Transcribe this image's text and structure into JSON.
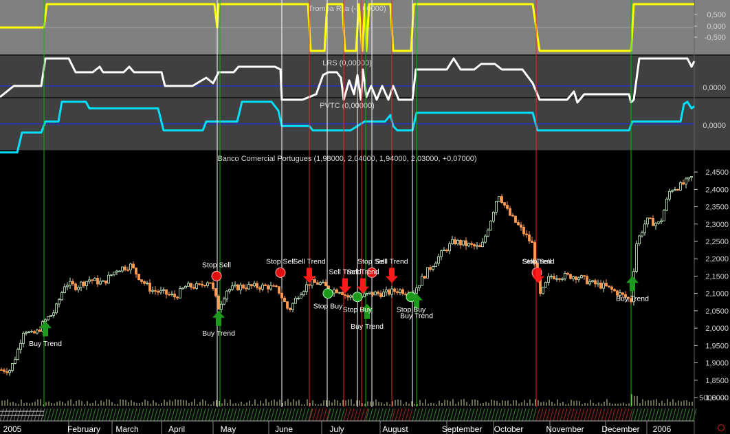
{
  "panels": {
    "tromba": {
      "title": "Tromba Rija (-1,00000)",
      "ticks": [
        "0,500",
        "0,000",
        "-0,500"
      ],
      "color": "#ffff00",
      "values": [
        [
          0,
          0
        ],
        [
          64,
          0
        ],
        [
          68,
          1
        ],
        [
          312,
          1
        ],
        [
          316,
          0
        ],
        [
          318,
          1
        ],
        [
          448,
          1
        ],
        [
          452,
          -1
        ],
        [
          472,
          -1
        ],
        [
          476,
          1
        ],
        [
          498,
          1
        ],
        [
          502,
          -1
        ],
        [
          518,
          -1
        ],
        [
          522,
          1
        ],
        [
          527,
          -1
        ],
        [
          531,
          1
        ],
        [
          533,
          -1
        ],
        [
          537,
          1
        ],
        [
          568,
          1
        ],
        [
          572,
          -1
        ],
        [
          598,
          -1
        ],
        [
          602,
          1
        ],
        [
          608,
          1
        ],
        [
          775,
          1
        ],
        [
          785,
          -1
        ],
        [
          918,
          -1
        ],
        [
          922,
          1
        ],
        [
          1010,
          1
        ]
      ]
    },
    "lrs": {
      "title": "LRS (0,00000)",
      "ticks": [
        "0,0000"
      ],
      "color": "#ffffff",
      "values": [
        [
          0,
          -0.4
        ],
        [
          20,
          0
        ],
        [
          60,
          0
        ],
        [
          66,
          1
        ],
        [
          100,
          1
        ],
        [
          110,
          0.5
        ],
        [
          135,
          0.5
        ],
        [
          145,
          0.7
        ],
        [
          150,
          0.5
        ],
        [
          180,
          0.5
        ],
        [
          188,
          0.7
        ],
        [
          195,
          0.5
        ],
        [
          235,
          0.5
        ],
        [
          240,
          0
        ],
        [
          268,
          0
        ],
        [
          280,
          0
        ],
        [
          300,
          0.3
        ],
        [
          310,
          0.1
        ],
        [
          318,
          0.5
        ],
        [
          340,
          0.5
        ],
        [
          347,
          0.7
        ],
        [
          400,
          0.7
        ],
        [
          408,
          0.6
        ],
        [
          410,
          -0.5
        ],
        [
          440,
          -0.5
        ],
        [
          460,
          -0.3
        ],
        [
          470,
          0.4
        ],
        [
          478,
          0.5
        ],
        [
          490,
          0.5
        ],
        [
          496,
          0.3
        ],
        [
          500,
          -0.5
        ],
        [
          508,
          0.2
        ],
        [
          515,
          -0.3
        ],
        [
          520,
          0.4
        ],
        [
          525,
          -0.5
        ],
        [
          528,
          0.6
        ],
        [
          533,
          -0.4
        ],
        [
          540,
          0
        ],
        [
          548,
          -0.5
        ],
        [
          556,
          0
        ],
        [
          565,
          -0.5
        ],
        [
          572,
          0
        ],
        [
          580,
          -0.5
        ],
        [
          590,
          -0.5
        ],
        [
          600,
          -0.5
        ],
        [
          605,
          0.6
        ],
        [
          650,
          0.6
        ],
        [
          660,
          1
        ],
        [
          670,
          0.6
        ],
        [
          690,
          0.6
        ],
        [
          700,
          0.8
        ],
        [
          720,
          0.8
        ],
        [
          730,
          0.6
        ],
        [
          760,
          0.6
        ],
        [
          775,
          0.1
        ],
        [
          785,
          -0.5
        ],
        [
          825,
          -0.5
        ],
        [
          835,
          -0.2
        ],
        [
          840,
          -0.6
        ],
        [
          850,
          -0.3
        ],
        [
          915,
          -0.3
        ],
        [
          918,
          -0.6
        ],
        [
          922,
          -0.5
        ],
        [
          930,
          1
        ],
        [
          1000,
          1
        ],
        [
          1006,
          0.7
        ],
        [
          1010,
          0.9
        ]
      ]
    },
    "pvtc": {
      "title": "PVTC (0,00000)",
      "ticks": [
        "0,0000"
      ],
      "color": "#00e0ff",
      "values": [
        [
          0,
          -1.3
        ],
        [
          25,
          -1.3
        ],
        [
          32,
          -0.4
        ],
        [
          60,
          -0.4
        ],
        [
          66,
          0.1
        ],
        [
          85,
          0.1
        ],
        [
          90,
          1
        ],
        [
          125,
          1
        ],
        [
          130,
          0.7
        ],
        [
          230,
          0.7
        ],
        [
          238,
          -0.3
        ],
        [
          295,
          -0.3
        ],
        [
          300,
          0.1
        ],
        [
          345,
          0.1
        ],
        [
          352,
          1
        ],
        [
          395,
          1
        ],
        [
          400,
          0.8
        ],
        [
          405,
          0.6
        ],
        [
          410,
          -0.1
        ],
        [
          450,
          -0.1
        ],
        [
          455,
          -0.3
        ],
        [
          510,
          -0.3
        ],
        [
          520,
          -0.1
        ],
        [
          530,
          0.1
        ],
        [
          560,
          0.1
        ],
        [
          568,
          0.4
        ],
        [
          572,
          -0.1
        ],
        [
          578,
          -0.3
        ],
        [
          600,
          -0.3
        ],
        [
          606,
          0.5
        ],
        [
          775,
          0.5
        ],
        [
          782,
          -0.3
        ],
        [
          915,
          -0.3
        ],
        [
          920,
          0.1
        ],
        [
          990,
          0.1
        ],
        [
          995,
          0.9
        ],
        [
          1000,
          1
        ],
        [
          1006,
          0.7
        ],
        [
          1010,
          0.8
        ]
      ]
    },
    "bg_color": "#808080",
    "bg2_color": "#404040"
  },
  "main_chart": {
    "title": "Banco Comercial Portugues (1,98000, 2,04000, 1,94000, 2,03000, +0,07000)",
    "y_ticks": [
      "2,4500",
      "2,4000",
      "2,3500",
      "2,3000",
      "2,2500",
      "2,2000",
      "2,1500",
      "2,1000",
      "2,0500",
      "2,0000",
      "1,9500",
      "1,9000",
      "1,8500",
      "1,8000"
    ],
    "volume_label": "5000000",
    "months": [
      "2005",
      "February",
      "March",
      "April",
      "May",
      "June",
      "July",
      "August",
      "September",
      "October",
      "November",
      "December",
      "2006"
    ],
    "up_color": "#c8f0c8",
    "down_color": "#ff9a50"
  },
  "chart_data": {
    "type": "candlestick",
    "title": "Banco Comercial Portugues (1,98000, 2,04000, 1,94000, 2,03000, +0,07000)",
    "ylim": [
      1.8,
      2.47
    ],
    "close_path": [
      [
        0,
        1.88
      ],
      [
        15,
        1.88
      ],
      [
        25,
        1.93
      ],
      [
        35,
        2.0
      ],
      [
        45,
        1.98
      ],
      [
        55,
        1.99
      ],
      [
        65,
        2.02
      ],
      [
        80,
        2.05
      ],
      [
        95,
        2.13
      ],
      [
        110,
        2.12
      ],
      [
        130,
        2.14
      ],
      [
        150,
        2.13
      ],
      [
        170,
        2.17
      ],
      [
        190,
        2.18
      ],
      [
        205,
        2.14
      ],
      [
        220,
        2.11
      ],
      [
        240,
        2.1
      ],
      [
        255,
        2.09
      ],
      [
        270,
        2.12
      ],
      [
        290,
        2.12
      ],
      [
        305,
        2.14
      ],
      [
        318,
        2.06
      ],
      [
        330,
        2.11
      ],
      [
        350,
        2.12
      ],
      [
        370,
        2.12
      ],
      [
        390,
        2.12
      ],
      [
        405,
        2.11
      ],
      [
        420,
        2.05
      ],
      [
        435,
        2.1
      ],
      [
        450,
        2.13
      ],
      [
        465,
        2.13
      ],
      [
        480,
        2.11
      ],
      [
        495,
        2.11
      ],
      [
        505,
        2.09
      ],
      [
        515,
        2.09
      ],
      [
        525,
        2.09
      ],
      [
        540,
        2.1
      ],
      [
        560,
        2.1
      ],
      [
        580,
        2.11
      ],
      [
        600,
        2.1
      ],
      [
        620,
        2.16
      ],
      [
        640,
        2.21
      ],
      [
        660,
        2.25
      ],
      [
        680,
        2.24
      ],
      [
        700,
        2.23
      ],
      [
        715,
        2.32
      ],
      [
        725,
        2.39
      ],
      [
        740,
        2.33
      ],
      [
        760,
        2.28
      ],
      [
        775,
        2.24
      ],
      [
        785,
        2.09
      ],
      [
        800,
        2.15
      ],
      [
        820,
        2.15
      ],
      [
        840,
        2.15
      ],
      [
        860,
        2.13
      ],
      [
        880,
        2.12
      ],
      [
        900,
        2.1
      ],
      [
        918,
        2.08
      ],
      [
        925,
        2.24
      ],
      [
        940,
        2.31
      ],
      [
        960,
        2.3
      ],
      [
        975,
        2.4
      ],
      [
        990,
        2.41
      ],
      [
        1005,
        2.43
      ],
      [
        1010,
        2.45
      ]
    ],
    "vertical_lines": [
      {
        "x": 64,
        "color": "#00c000"
      },
      {
        "x": 316,
        "color": "#ffffff"
      },
      {
        "x": 320,
        "color": "#00c000"
      },
      {
        "x": 410,
        "color": "#ffffff"
      },
      {
        "x": 450,
        "color": "#ff2020"
      },
      {
        "x": 476,
        "color": "#ffffff"
      },
      {
        "x": 500,
        "color": "#ff2020"
      },
      {
        "x": 520,
        "color": "#ffffff"
      },
      {
        "x": 526,
        "color": "#ff2020"
      },
      {
        "x": 532,
        "color": "#00c000"
      },
      {
        "x": 541,
        "color": "#ffffff"
      },
      {
        "x": 570,
        "color": "#ff2020"
      },
      {
        "x": 600,
        "color": "#ffffff"
      },
      {
        "x": 606,
        "color": "#00c000"
      },
      {
        "x": 780,
        "color": "#ff2020"
      },
      {
        "x": 918,
        "color": "#00c000"
      }
    ],
    "signals": [
      {
        "type": "buy",
        "x": 66,
        "price": 2.02,
        "label": "Buy Trend"
      },
      {
        "type": "stop",
        "x": 315,
        "price": 2.15,
        "label": "Stop Sell"
      },
      {
        "type": "buy",
        "x": 318,
        "price": 2.05,
        "label": "Buy Trend"
      },
      {
        "type": "stop",
        "x": 408,
        "price": 2.16,
        "label": "Stop Sell"
      },
      {
        "type": "sell",
        "x": 450,
        "price": 2.13,
        "label": "Sell Trend"
      },
      {
        "type": "stopbuy",
        "x": 477,
        "price": 2.1,
        "label": "Stop Buy"
      },
      {
        "type": "sell",
        "x": 502,
        "price": 2.1,
        "label": "Sell Trend"
      },
      {
        "type": "stopbuy",
        "x": 520,
        "price": 2.09,
        "label": "Stop Buy"
      },
      {
        "type": "sell",
        "x": 528,
        "price": 2.1,
        "label": "Sell Trend"
      },
      {
        "type": "buy",
        "x": 534,
        "price": 2.07,
        "label": "Buy Trend"
      },
      {
        "type": "stop",
        "x": 541,
        "price": 2.16,
        "label": "Stop Sell"
      },
      {
        "type": "sell",
        "x": 570,
        "price": 2.13,
        "label": "Sell Trend"
      },
      {
        "type": "stopbuy",
        "x": 598,
        "price": 2.09,
        "label": "Stop Buy"
      },
      {
        "type": "buy",
        "x": 606,
        "price": 2.1,
        "label": "Buy Trend"
      },
      {
        "type": "stop",
        "x": 781,
        "price": 2.16,
        "label": "Stop Sell"
      },
      {
        "type": "sell",
        "x": 783,
        "price": 2.13,
        "label": "Sell Trend"
      },
      {
        "type": "buy",
        "x": 920,
        "price": 2.15,
        "label": "Buy Trend"
      }
    ]
  }
}
